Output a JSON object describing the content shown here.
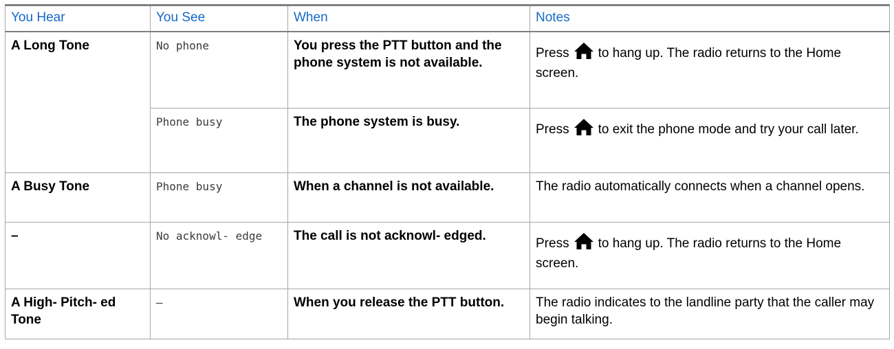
{
  "table": {
    "headers": {
      "hear": "You Hear",
      "see": "You See",
      "when": "When",
      "notes": "Notes"
    },
    "rows": [
      {
        "hear": "A Long Tone",
        "see": "No phone",
        "when": "You press the PTT button and the phone system is not available.",
        "notes_before": "Press",
        "notes_icon": "home-icon",
        "notes_after": "to hang up. The radio returns to the Home screen."
      },
      {
        "hear": "",
        "see": "Phone busy",
        "when": "The phone system is busy.",
        "notes_before": "Press",
        "notes_icon": "home-icon",
        "notes_after": "to exit the phone mode and try your call later."
      },
      {
        "hear": "A Busy Tone",
        "see": "Phone busy",
        "when": "When a channel is not available.",
        "notes": "The radio automatically connects when a channel opens."
      },
      {
        "hear": "–",
        "see": "No acknowl- edge",
        "when": "The call is not acknowl- edged.",
        "notes_before": "Press",
        "notes_icon": "home-icon",
        "notes_after": "to hang up. The radio returns to the Home screen."
      },
      {
        "hear": "A High- Pitch- ed Tone",
        "see": "–",
        "when": "When you release the PTT button.",
        "notes": "The radio indicates to the landline party that the caller may begin talking."
      }
    ]
  },
  "colors": {
    "header_text": "#1469c7",
    "rule": "#7f7f7f",
    "grid": "#a6a6a6"
  }
}
